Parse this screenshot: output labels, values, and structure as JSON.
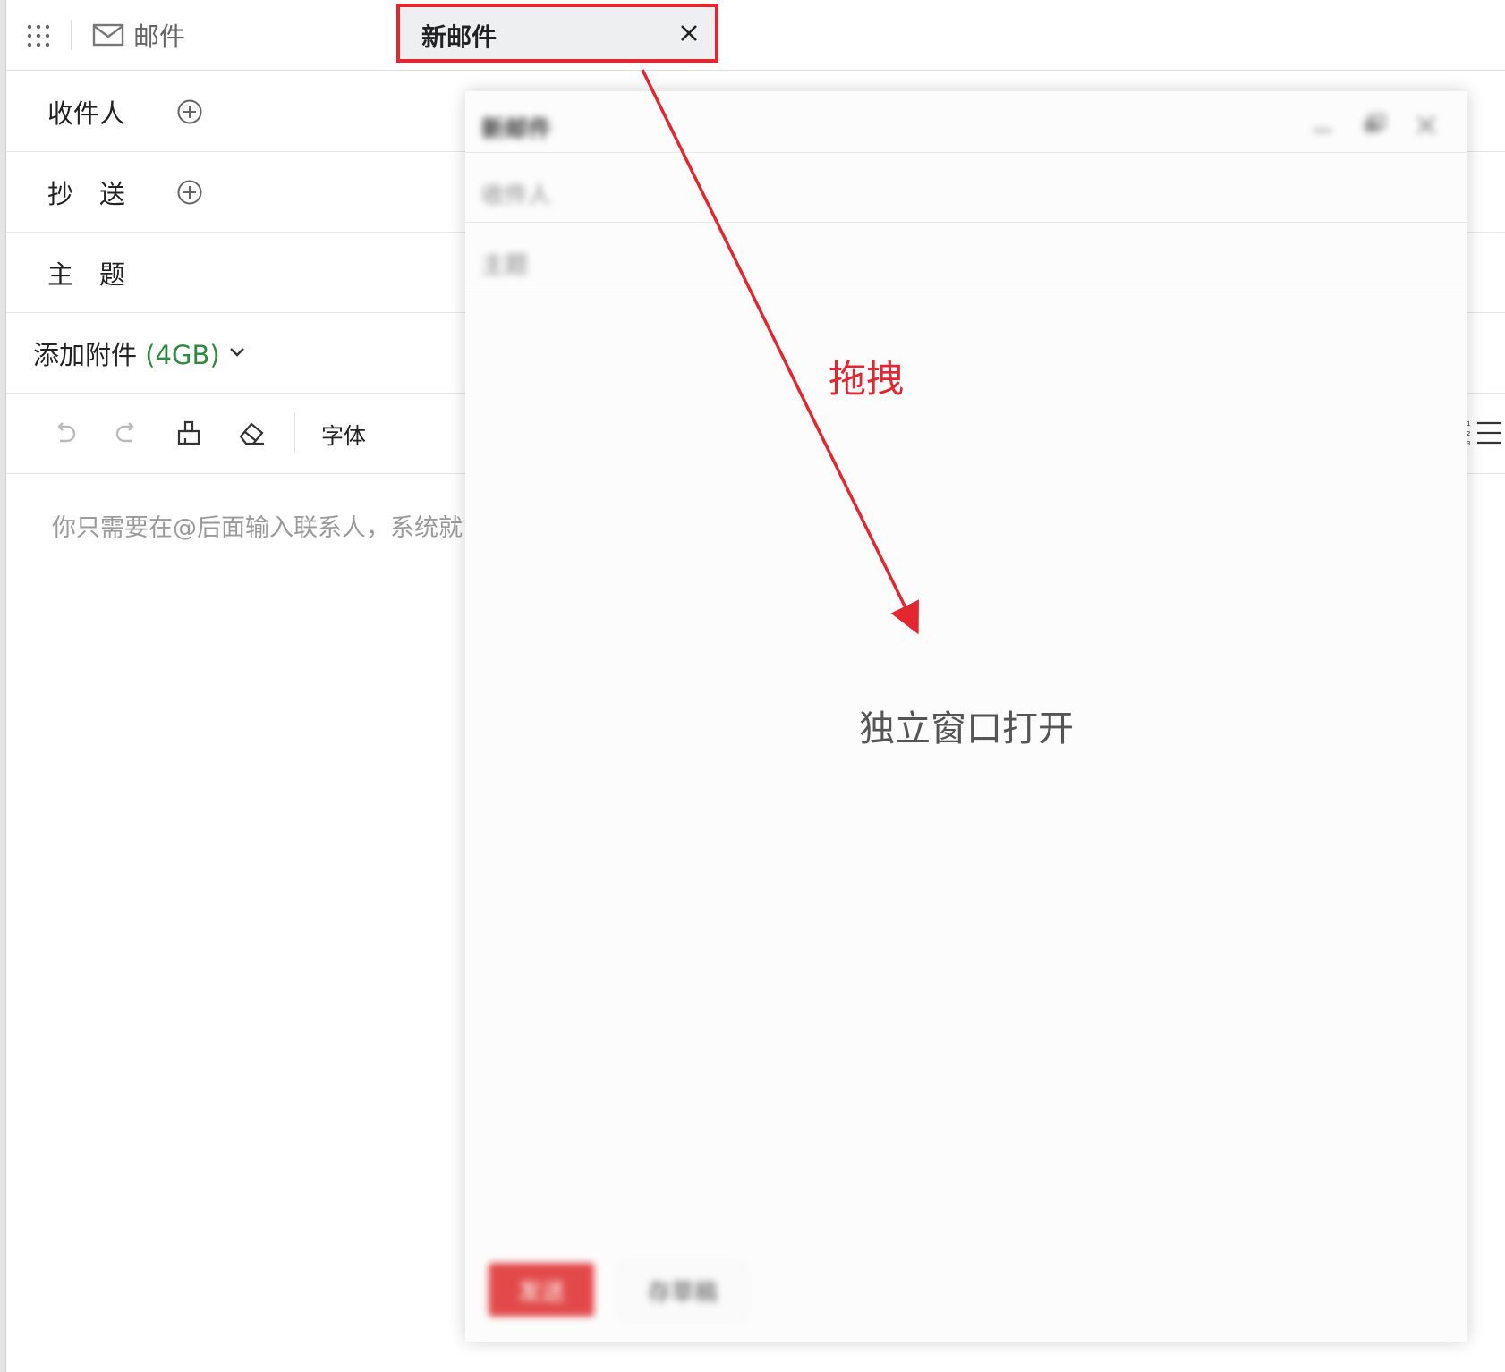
{
  "header": {
    "mail_tab_label": "邮件",
    "new_tab_label": "新邮件"
  },
  "form": {
    "to_label": "收件人",
    "cc_label": "抄　送",
    "subject_label": "主　题",
    "attach_label": "添加附件",
    "attach_size": "(4GB)"
  },
  "toolbar": {
    "font_label": "字体"
  },
  "editor": {
    "placeholder": "你只需要在@后面输入联系人，系统就"
  },
  "floating_window": {
    "title": "新邮件",
    "to_label": "收件人",
    "subject_label": "主题",
    "send_label": "发送",
    "draft_label": "存草稿",
    "caption": "独立窗口打开"
  },
  "annotation": {
    "drag_label": "拖拽",
    "color": "#e3262f"
  },
  "colors": {
    "accent_red": "#e3262f",
    "attach_green": "#2e8b3e"
  }
}
